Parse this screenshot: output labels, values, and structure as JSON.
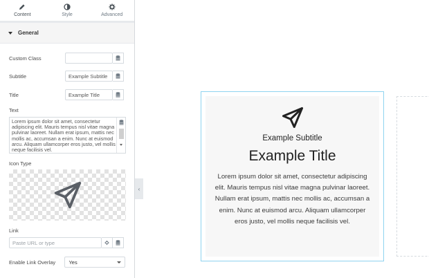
{
  "tabs": [
    {
      "label": "Content",
      "icon": "pencil-icon",
      "active": true
    },
    {
      "label": "Style",
      "icon": "half-circle-icon",
      "active": false
    },
    {
      "label": "Advanced",
      "icon": "gear-icon",
      "active": false
    }
  ],
  "section": {
    "title": "General"
  },
  "fields": {
    "custom_class": {
      "label": "Custom Class",
      "value": ""
    },
    "subtitle": {
      "label": "Subtitle",
      "value": "Example Subtitle"
    },
    "title": {
      "label": "Title",
      "value": "Example Title"
    },
    "text": {
      "label": "Text",
      "value": "Lorem ipsum dolor sit amet, consectetur adipiscing elit. Mauris tempus nisl vitae magna pulvinar laoreet. Nullam erat ipsum, mattis nec mollis ac, accumsan a enim. Nunc at euismod arcu. Aliquam ullamcorper eros justo, vel mollis neque facilisis vel."
    },
    "icon_type": {
      "label": "Icon Type",
      "icon": "paper-plane-icon"
    },
    "link": {
      "label": "Link",
      "placeholder": "Paste URL or type"
    },
    "link_overlay": {
      "label": "Enable Link Overlay",
      "value": "Yes"
    }
  },
  "preview": {
    "icon": "paper-plane-icon",
    "subtitle": "Example Subtitle",
    "title": "Example Title",
    "text": "Lorem ipsum dolor sit amet, consectetur adipiscing elit. Mauris tempus nisl vitae magna pulvinar laoreet. Nullam erat ipsum, mattis nec mollis ac, accumsan a enim. Nunc at euismod arcu. Aliquam ullamcorper eros justo, vel mollis neque facilisis vel."
  },
  "colors": {
    "preview_border": "#8ed3f0",
    "panel_tab_border": "#e6e9ec"
  }
}
